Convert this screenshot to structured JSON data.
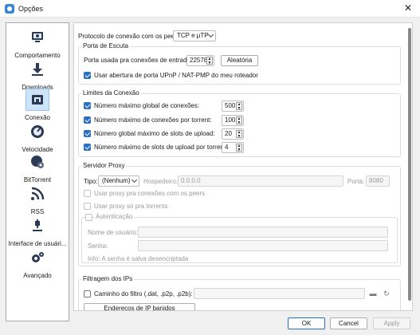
{
  "window": {
    "title": "Opções",
    "close_glyph": "✕"
  },
  "sidebar": {
    "items": [
      {
        "label": "Comportamento",
        "icon": "monitor-icon"
      },
      {
        "label": "Downloads",
        "icon": "download-icon"
      },
      {
        "label": "Conexão",
        "icon": "network-icon",
        "selected": true
      },
      {
        "label": "Velocidade",
        "icon": "speedometer-icon"
      },
      {
        "label": "BitTorrent",
        "icon": "globe-gear-icon"
      },
      {
        "label": "RSS",
        "icon": "rss-icon"
      },
      {
        "label": "Interface de usuári...",
        "icon": "webui-icon"
      },
      {
        "label": "Avançado",
        "icon": "gears-icon"
      }
    ]
  },
  "protocol": {
    "label": "Protocolo de conexão com os peers:",
    "value": "TCP e μTP"
  },
  "listening": {
    "title": "Porta de Escuta",
    "port_label": "Porta usada pra conexões de entrada:",
    "port_value": "22578",
    "random_button": "Aleatória",
    "upnp_label": "Usar abertura de porta UPnP / NAT-PMP do meu roteador",
    "upnp_checked": true
  },
  "limits": {
    "title": "Limites da Conexão",
    "rows": [
      {
        "label": "Número máximo global de conexões:",
        "value": "500",
        "checked": true
      },
      {
        "label": "Número máximo de conexões por torrent:",
        "value": "100",
        "checked": true
      },
      {
        "label": "Número global máximo de slots de upload:",
        "value": "20",
        "checked": true
      },
      {
        "label": "Número máximo de slots de upload por torrent:",
        "value": "4",
        "checked": true
      }
    ]
  },
  "proxy": {
    "title": "Servidor Proxy",
    "type_label": "Tipo:",
    "type_value": "(Nenhum)",
    "host_label": "Hospedeiro:",
    "host_placeholder": "0.0.0.0",
    "port_label": "Porta:",
    "port_value": "8080",
    "peer_proxy_label": "Usar proxy pra conexões com os peers",
    "torrent_only_label": "Usar proxy só pra torrents",
    "auth_title": "Autenticação",
    "username_label": "Nome de usuário:",
    "password_label": "Senha:",
    "info": "Info: A senha é salva desencriptada"
  },
  "ipfilter": {
    "title": "Filtragem dos IPs",
    "path_label": "Caminho do filtro (.dat, .p2p, .p2b):",
    "path_checked": false,
    "banned_button": "Endereços de IP banidos manualmente..."
  },
  "footer": {
    "ok": "OK",
    "cancel": "Cancel",
    "apply": "Apply"
  },
  "colors": {
    "accent": "#2a6fc6",
    "selection": "#cde3f8"
  }
}
